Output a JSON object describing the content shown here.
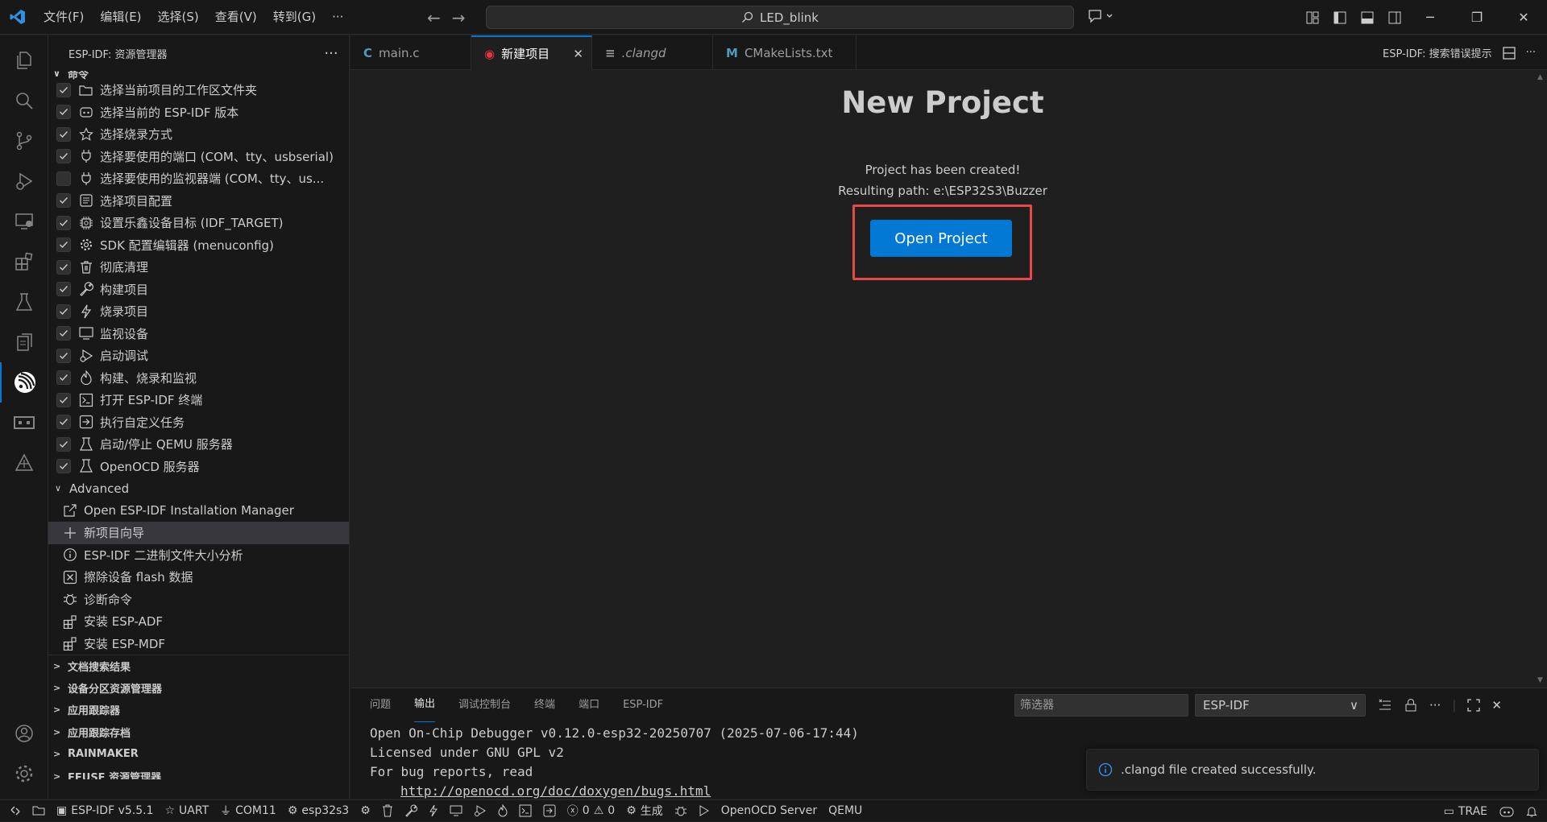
{
  "menu": [
    "文件(F)",
    "编辑(E)",
    "选择(S)",
    "查看(V)",
    "转到(G)",
    "···"
  ],
  "search": {
    "text": "LED_blink"
  },
  "sidebar": {
    "title": "ESP-IDF: 资源管理器",
    "commands_header": "命令",
    "commands": [
      {
        "label": "选择当前项目的工作区文件夹",
        "checked": true,
        "icon": "folder-icon"
      },
      {
        "label": "选择当前的 ESP-IDF 版本",
        "checked": true,
        "icon": "esp-idf-icon"
      },
      {
        "label": "选择烧录方式",
        "checked": true,
        "icon": "star-icon"
      },
      {
        "label": "选择要使用的端口 (COM、tty、usbserial)",
        "checked": true,
        "icon": "plug-icon"
      },
      {
        "label": "选择要使用的监视器端 (COM、tty、us...",
        "checked": false,
        "icon": "plug-icon"
      },
      {
        "label": "选择项目配置",
        "checked": true,
        "icon": "config-icon"
      },
      {
        "label": "设置乐鑫设备目标 (IDF_TARGET)",
        "checked": true,
        "icon": "chip-icon"
      },
      {
        "label": "SDK 配置编辑器 (menuconfig)",
        "checked": true,
        "icon": "gear-icon"
      },
      {
        "label": "彻底清理",
        "checked": true,
        "icon": "trash-icon"
      },
      {
        "label": "构建项目",
        "checked": true,
        "icon": "wrench-icon"
      },
      {
        "label": "烧录项目",
        "checked": true,
        "icon": "flash-icon"
      },
      {
        "label": "监视设备",
        "checked": true,
        "icon": "monitor-icon"
      },
      {
        "label": "启动调试",
        "checked": true,
        "icon": "debug-icon"
      },
      {
        "label": "构建、烧录和监视",
        "checked": true,
        "icon": "flame-icon"
      },
      {
        "label": "打开 ESP-IDF 终端",
        "checked": true,
        "icon": "terminal-icon"
      },
      {
        "label": "执行自定义任务",
        "checked": true,
        "icon": "run-task-icon"
      },
      {
        "label": "启动/停止 QEMU 服务器",
        "checked": true,
        "icon": "beaker-icon"
      },
      {
        "label": "OpenOCD 服务器",
        "checked": true,
        "icon": "beaker-icon"
      }
    ],
    "advanced_header": "Advanced",
    "advanced": [
      {
        "label": "Open ESP-IDF Installation Manager",
        "icon": "open-external-icon"
      },
      {
        "label": "新项目向导",
        "icon": "plus-icon"
      },
      {
        "label": "ESP-IDF 二进制文件大小分析",
        "icon": "info-icon"
      },
      {
        "label": "擦除设备 flash 数据",
        "icon": "erase-icon"
      },
      {
        "label": "诊断命令",
        "icon": "bug-icon"
      },
      {
        "label": "安装 ESP-ADF",
        "icon": "extensions-icon"
      },
      {
        "label": "安装 ESP-MDF",
        "icon": "extensions-icon"
      }
    ],
    "sections": [
      "文档搜索结果",
      "设备分区资源管理器",
      "应用跟踪器",
      "应用跟踪存档",
      "RAINMAKER",
      "EFUSE 资源管理器"
    ]
  },
  "tabs": [
    {
      "label": "main.c",
      "icon_text": "C",
      "icon_color": "#519aba"
    },
    {
      "label": "新建项目",
      "icon_text": "◉",
      "icon_color": "#e7353a"
    },
    {
      "label": ".clangd",
      "icon_text": "≡",
      "icon_color": "#9d9d9d"
    },
    {
      "label": "CMakeLists.txt",
      "icon_text": "M",
      "icon_color": "#519aba"
    }
  ],
  "tab_right_label": "ESP-IDF: 搜索错误提示",
  "editor": {
    "title": "New Project",
    "msg1": "Project has been created!",
    "msg2": "Resulting path: e:\\ESP32S3\\Buzzer",
    "button": "Open Project"
  },
  "panel": {
    "tabs": [
      "问题",
      "输出",
      "调试控制台",
      "终端",
      "端口",
      "ESP-IDF"
    ],
    "filter_placeholder": "筛选器",
    "channel": "ESP-IDF",
    "lines": [
      "Open On-Chip Debugger v0.12.0-esp32-20250707 (2025-07-06-17:44)",
      "Licensed under GNU GPL v2",
      "For bug reports, read"
    ],
    "link": "http://openocd.org/doc/doxygen/bugs.html"
  },
  "toast": {
    "text": ".clangd file created successfully."
  },
  "status": {
    "idf": "ESP-IDF v5.5.1",
    "flash": "UART",
    "port": "COM11",
    "target": "esp32s3",
    "errors": "0",
    "warnings": "0",
    "build": "生成",
    "openocd": "OpenOCD Server",
    "qemu": "QEMU",
    "trae": "TRAE"
  },
  "colors": {
    "accent": "#0078d4",
    "highlight_box": "#e8484a",
    "bg": "#1f1f1f",
    "panel_bg": "#181818"
  }
}
